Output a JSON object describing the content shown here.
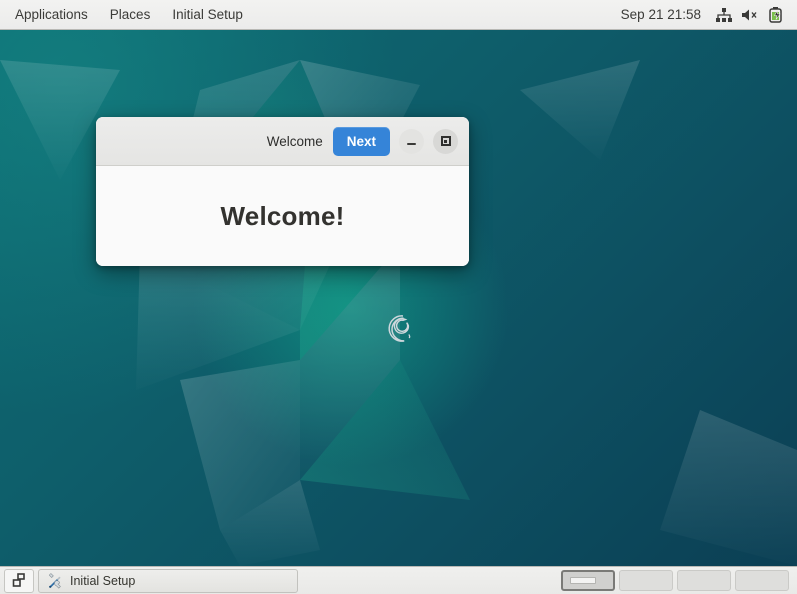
{
  "panel": {
    "menus": [
      {
        "label": "Applications",
        "name": "menu-applications"
      },
      {
        "label": "Places",
        "name": "menu-places"
      },
      {
        "label": "Initial Setup",
        "name": "menu-initial-setup"
      }
    ],
    "clock": "Sep 21  21:58",
    "tray": [
      {
        "name": "network-wired-icon",
        "label": "network-wired"
      },
      {
        "name": "volume-muted-icon",
        "label": "volume-muted"
      },
      {
        "name": "battery-charging-icon",
        "label": "battery-charging"
      }
    ]
  },
  "window": {
    "title": "Welcome",
    "next_label": "Next",
    "minimize_label": "Minimize",
    "maximize_label": "Maximize",
    "heading": "Welcome!"
  },
  "taskbar": {
    "show_desktop_label": "Show Desktop",
    "task_label": "Initial Setup",
    "task_icon": "tools-icon",
    "workspaces": [
      {
        "label": "Workspace 1",
        "active": true
      },
      {
        "label": "Workspace 2",
        "active": false
      },
      {
        "label": "Workspace 3",
        "active": false
      },
      {
        "label": "Workspace 4",
        "active": false
      }
    ]
  },
  "desktop": {
    "logo": "debian-swirl-logo"
  },
  "colors": {
    "accent_blue": "#3584d8",
    "panel_gray": "#efefee",
    "wallpaper_teal": "#0d5261",
    "window_body": "#fafafa"
  }
}
